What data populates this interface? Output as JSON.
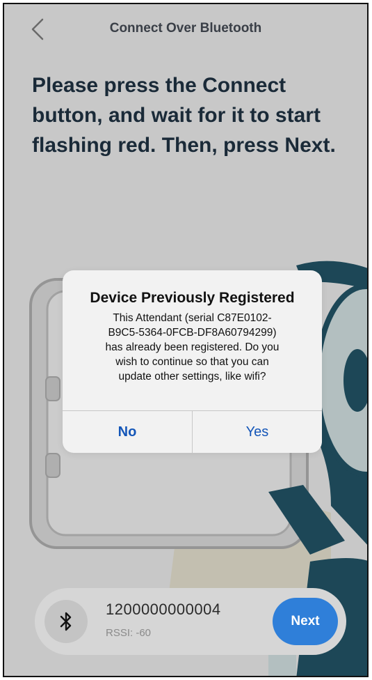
{
  "header": {
    "title": "Connect Over Bluetooth",
    "back_icon": "chevron-left-icon"
  },
  "instruction": "Please press the Connect button, and wait for it to start flashing red.  Then, press Next.",
  "dialog": {
    "title": "Device Previously Registered",
    "message": "This Attendant (serial C87E0102-\nB9C5-5364-0FCB-DF8A60794299)\nhas already been registered.  Do you\nwish to continue so that you can\nupdate other settings, like wifi?",
    "no_label": "No",
    "yes_label": "Yes"
  },
  "device": {
    "name": "1200000000004",
    "rssi": "RSSI: -60",
    "icon": "bluetooth-icon"
  },
  "next_label": "Next",
  "colors": {
    "background": "#cfcfcf",
    "primary_blue": "#2f7fd9",
    "dialog_link": "#1456b8",
    "robot_teal": "#1e4a5a",
    "robot_light": "#b9c6c7"
  }
}
